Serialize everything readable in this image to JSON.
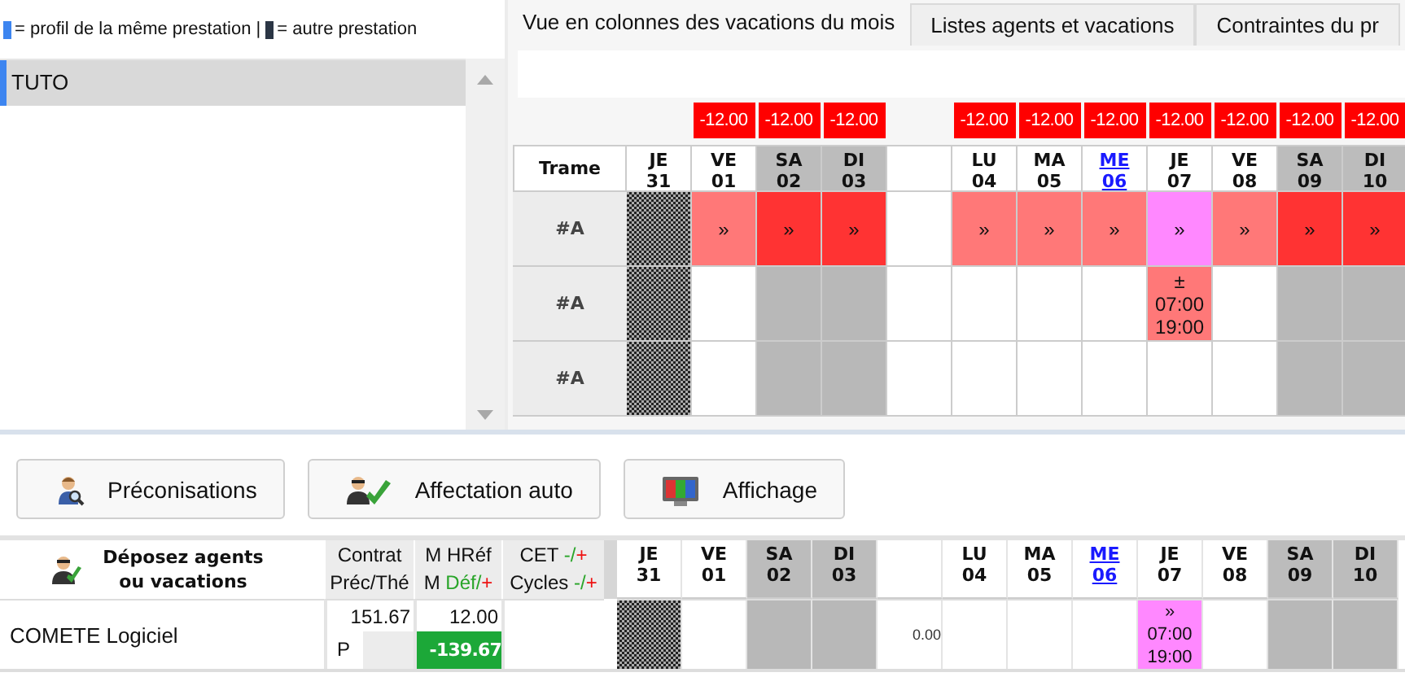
{
  "legend": [
    {
      "color": "#3d85f0",
      "text": "= profil de la même prestation |"
    },
    {
      "color": "#2b3645",
      "text": "= autre prestation"
    }
  ],
  "profiles": [
    {
      "label": "TUTO",
      "selected": true,
      "color": "#3d85f0"
    }
  ],
  "tabs": [
    {
      "label": "Vue en colonnes des vacations du mois",
      "selected": true
    },
    {
      "label": "Listes agents et vacations",
      "selected": false
    },
    {
      "label": "Contraintes du pr",
      "selected": false
    }
  ],
  "schedule": {
    "corner": "Trame",
    "columns": [
      {
        "kind": "day",
        "weekday": "JE",
        "date": "31",
        "weekend": false,
        "link": false
      },
      {
        "kind": "day",
        "weekday": "VE",
        "date": "01",
        "weekend": false,
        "link": false,
        "total": "-12.00"
      },
      {
        "kind": "day",
        "weekday": "SA",
        "date": "02",
        "weekend": true,
        "link": false,
        "total": "-12.00"
      },
      {
        "kind": "day",
        "weekday": "DI",
        "date": "03",
        "weekend": true,
        "link": false,
        "total": "-12.00"
      },
      {
        "kind": "gap"
      },
      {
        "kind": "day",
        "weekday": "LU",
        "date": "04",
        "weekend": false,
        "link": false,
        "total": "-12.00"
      },
      {
        "kind": "day",
        "weekday": "MA",
        "date": "05",
        "weekend": false,
        "link": false,
        "total": "-12.00"
      },
      {
        "kind": "day",
        "weekday": "ME",
        "date": "06",
        "weekend": false,
        "link": true,
        "total": "-12.00"
      },
      {
        "kind": "day",
        "weekday": "JE",
        "date": "07",
        "weekend": false,
        "link": false,
        "total": "-12.00"
      },
      {
        "kind": "day",
        "weekday": "VE",
        "date": "08",
        "weekend": false,
        "link": false,
        "total": "-12.00"
      },
      {
        "kind": "day",
        "weekday": "SA",
        "date": "09",
        "weekend": true,
        "link": false,
        "total": "-12.00"
      },
      {
        "kind": "day",
        "weekday": "DI",
        "date": "10",
        "weekend": true,
        "link": false,
        "total": "-12.00"
      }
    ],
    "rows": [
      {
        "label": "#A",
        "cells": [
          {
            "kind": "hatched"
          },
          {
            "kind": "salmon",
            "lines": [
              "»"
            ]
          },
          {
            "kind": "red",
            "lines": [
              "»"
            ]
          },
          {
            "kind": "red",
            "lines": [
              "»"
            ]
          },
          {
            "kind": "empty"
          },
          {
            "kind": "salmon",
            "lines": [
              "»"
            ]
          },
          {
            "kind": "salmon",
            "lines": [
              "»"
            ]
          },
          {
            "kind": "salmon",
            "lines": [
              "»"
            ]
          },
          {
            "kind": "pink",
            "lines": [
              "»"
            ]
          },
          {
            "kind": "salmon",
            "lines": [
              "»"
            ]
          },
          {
            "kind": "red",
            "lines": [
              "»"
            ]
          },
          {
            "kind": "red",
            "lines": [
              "»"
            ]
          }
        ]
      },
      {
        "label": "#A",
        "cells": [
          {
            "kind": "hatched"
          },
          {
            "kind": "empty"
          },
          {
            "kind": "weekend"
          },
          {
            "kind": "weekend"
          },
          {
            "kind": "empty"
          },
          {
            "kind": "empty"
          },
          {
            "kind": "empty"
          },
          {
            "kind": "empty"
          },
          {
            "kind": "salmon",
            "lines": [
              "±",
              "07:00",
              "19:00"
            ]
          },
          {
            "kind": "empty"
          },
          {
            "kind": "weekend"
          },
          {
            "kind": "weekend"
          }
        ]
      },
      {
        "label": "#A",
        "cells": [
          {
            "kind": "hatched"
          },
          {
            "kind": "empty"
          },
          {
            "kind": "weekend"
          },
          {
            "kind": "weekend"
          },
          {
            "kind": "empty"
          },
          {
            "kind": "empty"
          },
          {
            "kind": "empty"
          },
          {
            "kind": "empty"
          },
          {
            "kind": "empty"
          },
          {
            "kind": "empty"
          },
          {
            "kind": "weekend"
          },
          {
            "kind": "weekend"
          }
        ]
      }
    ]
  },
  "buttons": [
    {
      "label": "Préconisations"
    },
    {
      "label": "Affectation auto"
    },
    {
      "label": "Affichage"
    }
  ],
  "agents": {
    "drop_label": "Déposez agents ou vacations",
    "stat_headers": [
      {
        "lines": [
          [
            {
              "text": "Contrat",
              "kind": "plain"
            }
          ],
          [
            {
              "text": "Préc/Thé",
              "kind": "plain"
            }
          ]
        ]
      },
      {
        "lines": [
          [
            {
              "text": "M HRéf",
              "kind": "plain"
            }
          ],
          [
            {
              "text": "M ",
              "kind": "plain"
            },
            {
              "text": "Déf/",
              "kind": "minus"
            },
            {
              "text": "+",
              "kind": "plus"
            }
          ]
        ]
      },
      {
        "lines": [
          [
            {
              "text": "CET ",
              "kind": "plain"
            },
            {
              "text": "-/",
              "kind": "minus"
            },
            {
              "text": "+",
              "kind": "plus"
            }
          ],
          [
            {
              "text": "Cycles ",
              "kind": "plain"
            },
            {
              "text": "-/",
              "kind": "minus"
            },
            {
              "text": "+",
              "kind": "plus"
            }
          ]
        ]
      }
    ],
    "columns": [
      {
        "kind": "day",
        "weekday": "JE",
        "date": "31",
        "weekend": false,
        "link": false
      },
      {
        "kind": "day",
        "weekday": "VE",
        "date": "01",
        "weekend": false,
        "link": false
      },
      {
        "kind": "day",
        "weekday": "SA",
        "date": "02",
        "weekend": true,
        "link": false
      },
      {
        "kind": "day",
        "weekday": "DI",
        "date": "03",
        "weekend": true,
        "link": false
      },
      {
        "kind": "gap"
      },
      {
        "kind": "day",
        "weekday": "LU",
        "date": "04",
        "weekend": false,
        "link": false
      },
      {
        "kind": "day",
        "weekday": "MA",
        "date": "05",
        "weekend": false,
        "link": false
      },
      {
        "kind": "day",
        "weekday": "ME",
        "date": "06",
        "weekend": false,
        "link": true
      },
      {
        "kind": "day",
        "weekday": "JE",
        "date": "07",
        "weekend": false,
        "link": false
      },
      {
        "kind": "day",
        "weekday": "VE",
        "date": "08",
        "weekend": false,
        "link": false
      },
      {
        "kind": "day",
        "weekday": "SA",
        "date": "09",
        "weekend": true,
        "link": false
      },
      {
        "kind": "day",
        "weekday": "DI",
        "date": "10",
        "weekend": true,
        "link": false
      }
    ],
    "rows": [
      {
        "name": "COMETE Logiciel",
        "contract": "151.67",
        "status": "P",
        "hours_ref": "12.00",
        "balance": "-139.67",
        "balance_highlighted": true,
        "cells": [
          {
            "kind": "hatched"
          },
          {
            "kind": "empty"
          },
          {
            "kind": "weekend"
          },
          {
            "kind": "weekend"
          },
          {
            "kind": "empty",
            "lines": [
              "0.00"
            ]
          },
          {
            "kind": "empty"
          },
          {
            "kind": "empty"
          },
          {
            "kind": "empty"
          },
          {
            "kind": "pink",
            "lines": [
              "»",
              "07:00",
              "19:00"
            ]
          },
          {
            "kind": "empty"
          },
          {
            "kind": "weekend"
          },
          {
            "kind": "weekend"
          }
        ]
      }
    ]
  }
}
